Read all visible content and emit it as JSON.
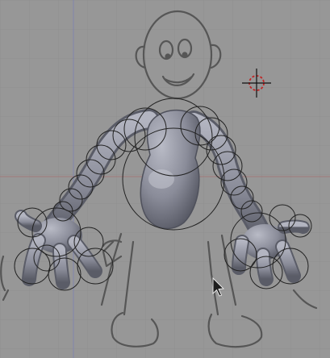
{
  "viewport": {
    "background": "#979797",
    "grid_color": "#8f8f8f",
    "x_axis_color": "#a86b6b",
    "y_axis_color": "#7a7fb8",
    "sketch_stroke": "#565656",
    "mesh_fill": "#8a8c99",
    "mesh_highlight": "#b9bbc6",
    "mesh_shadow": "#4f515c",
    "envelope_stroke": "#222222",
    "cursor_ring": "#c02525",
    "cursor_crosshair": "#111111",
    "pointer_color": "#1e1e1e",
    "icons": [
      "3d-cursor-icon",
      "mouse-pointer-icon"
    ]
  }
}
